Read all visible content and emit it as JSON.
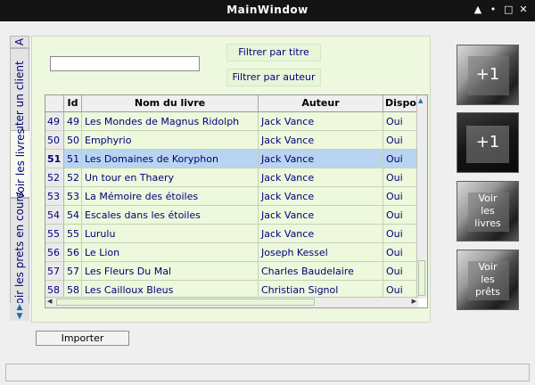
{
  "window": {
    "title": "MainWindow",
    "controls": [
      "▲",
      "•",
      "□",
      "✕"
    ]
  },
  "tabs": {
    "scroll_left": "▲",
    "scroll_right": "▼",
    "items": [
      {
        "label": "A"
      },
      {
        "label": "Ajouter un client"
      },
      {
        "label": "Voir les livres"
      },
      {
        "label": "Voir les prets en cours"
      }
    ],
    "active": "Voir les livres"
  },
  "filters": {
    "search_value": "",
    "by_title_label": "Filtrer par titre",
    "by_author_label": "Filtrer par auteur"
  },
  "table": {
    "columns": [
      "Id",
      "Nom du livre",
      "Auteur",
      "Dispon"
    ],
    "selected_row": 2,
    "rows": [
      {
        "rownum": "49",
        "id": "49",
        "title": "Les Mondes de Magnus Ridolph",
        "author": "Jack Vance",
        "dispo": "Oui"
      },
      {
        "rownum": "50",
        "id": "50",
        "title": "Emphyrio",
        "author": "Jack Vance",
        "dispo": "Oui"
      },
      {
        "rownum": "51",
        "id": "51",
        "title": "Les Domaines de Koryphon",
        "author": "Jack Vance",
        "dispo": "Oui"
      },
      {
        "rownum": "52",
        "id": "52",
        "title": "Un tour en Thaery",
        "author": "Jack Vance",
        "dispo": "Oui"
      },
      {
        "rownum": "53",
        "id": "53",
        "title": "La Mémoire des étoiles",
        "author": "Jack Vance",
        "dispo": "Oui"
      },
      {
        "rownum": "54",
        "id": "54",
        "title": "Escales dans les étoiles",
        "author": "Jack Vance",
        "dispo": "Oui"
      },
      {
        "rownum": "55",
        "id": "55",
        "title": "Lurulu",
        "author": "Jack Vance",
        "dispo": "Oui"
      },
      {
        "rownum": "56",
        "id": "56",
        "title": "Le Lion",
        "author": "Joseph Kessel",
        "dispo": "Oui"
      },
      {
        "rownum": "57",
        "id": "57",
        "title": "Les Fleurs Du Mal",
        "author": "Charles Baudelaire",
        "dispo": "Oui"
      },
      {
        "rownum": "58",
        "id": "58",
        "title": "Les Cailloux Bleus",
        "author": "Christian Signol",
        "dispo": "Oui"
      }
    ]
  },
  "actions": {
    "import_label": "Importer",
    "add_book_label": "+1",
    "add_client_label": "+1",
    "view_books_label": "Voir les livres",
    "view_loans_label": "Voir les prêts"
  }
}
